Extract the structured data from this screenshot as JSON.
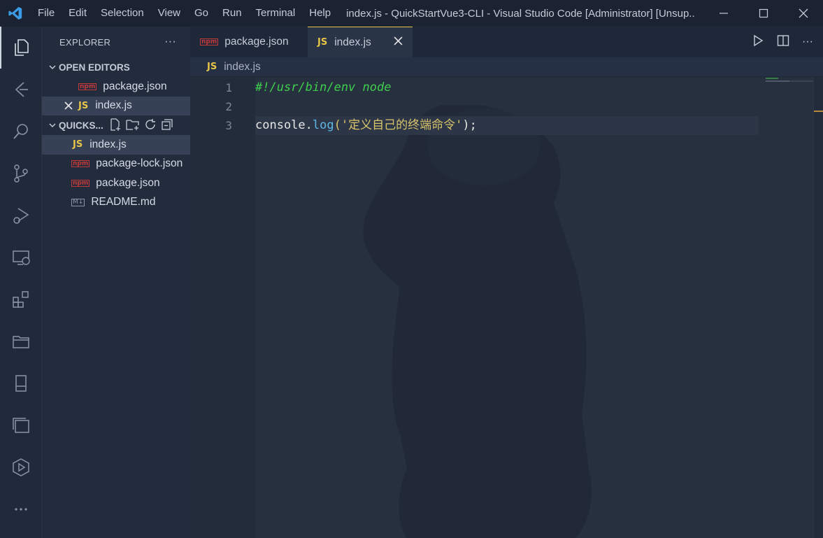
{
  "titlebar": {
    "menu": [
      "File",
      "Edit",
      "Selection",
      "View",
      "Go",
      "Run",
      "Terminal",
      "Help"
    ],
    "title": "index.js - QuickStartVue3-CLI - Visual Studio Code [Administrator] [Unsup..."
  },
  "sidebar": {
    "header": "EXPLORER",
    "open_editors_label": "OPEN EDITORS",
    "open_editors": [
      {
        "name": "package.json",
        "type": "npm"
      },
      {
        "name": "index.js",
        "type": "js"
      }
    ],
    "folder_label": "QUICKS...",
    "files": [
      {
        "name": "index.js",
        "type": "js"
      },
      {
        "name": "package-lock.json",
        "type": "npm"
      },
      {
        "name": "package.json",
        "type": "npm"
      },
      {
        "name": "README.md",
        "type": "md"
      }
    ]
  },
  "tabs": [
    {
      "label": "package.json",
      "active": false
    },
    {
      "label": "index.js",
      "active": true
    }
  ],
  "breadcrumb": "index.js",
  "code": {
    "line_numbers": [
      "1",
      "2",
      "3"
    ],
    "line1": "#!/usr/bin/env node",
    "line3_obj": "console",
    "line3_dot": ".",
    "line3_fn": "log",
    "line3_open": "(",
    "line3_str": "'定义自己的终端命令'",
    "line3_close": ");"
  },
  "icons": {
    "js_badge": "JS",
    "npm_badge": "npm",
    "md_badge": "M↓"
  },
  "colors": {
    "accent": "#e8c547",
    "vscode_blue": "#3c9be5"
  }
}
